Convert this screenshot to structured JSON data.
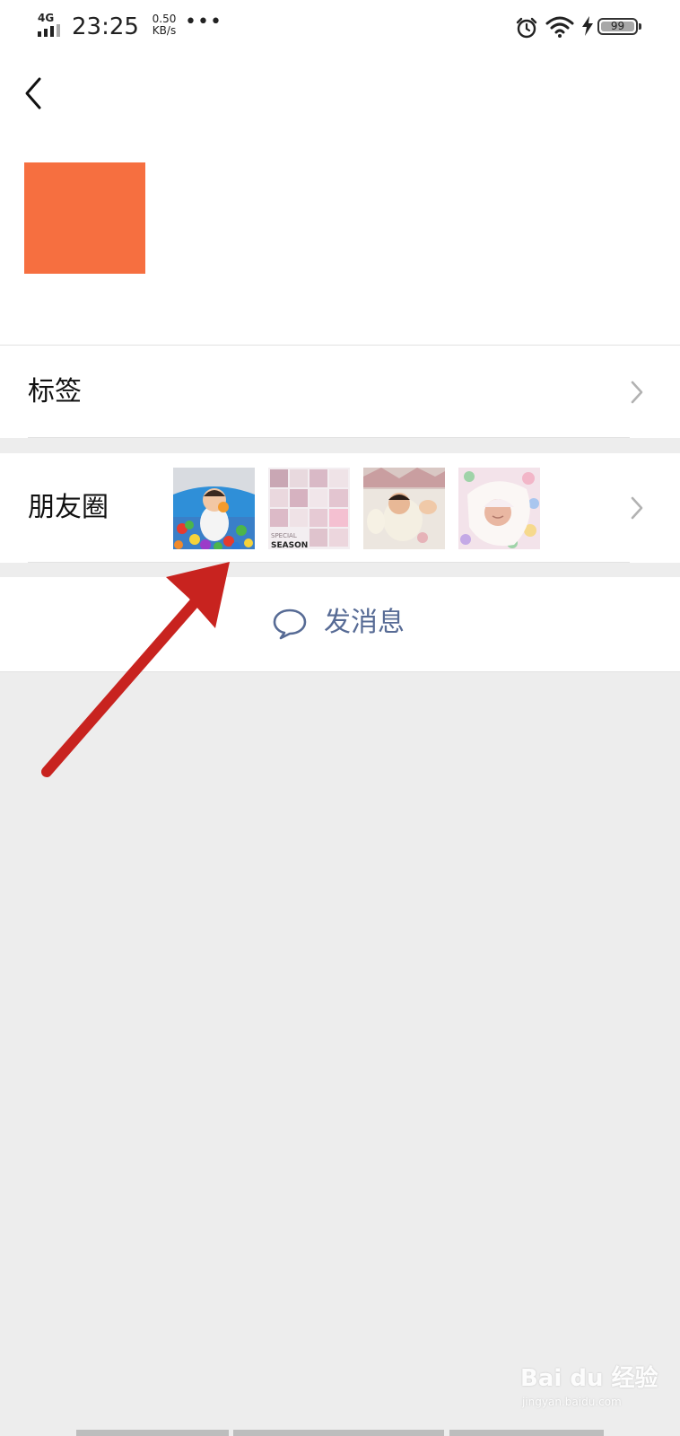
{
  "status_bar": {
    "network_type": "4G",
    "time": "23:25",
    "speed_value": "0.50",
    "speed_unit": "KB/s",
    "more": "•••",
    "battery_level": "99",
    "icons": [
      "signal-icon",
      "alarm-icon",
      "wifi-icon",
      "charging-icon",
      "battery-icon"
    ]
  },
  "nav": {
    "back_icon": "chevron-left-icon"
  },
  "profile": {
    "avatar_color": "#f66f40"
  },
  "rows": {
    "tags": {
      "label": "标签"
    },
    "moments": {
      "label": "朋友圈",
      "thumbnails": [
        {
          "name": "baby-in-ball-pool"
        },
        {
          "name": "pink-collage",
          "caption_small": "SPECIAL",
          "caption_big": "SEASON"
        },
        {
          "name": "newborn-on-bed"
        },
        {
          "name": "newborn-in-blanket"
        }
      ]
    }
  },
  "send_message": {
    "label": "发消息",
    "icon": "chat-bubble-icon",
    "color": "#576b95"
  },
  "annotation": {
    "arrow_color": "#c8231f"
  },
  "watermark": {
    "brand": "Bai du 经验",
    "url": "jingyan.baidu.com"
  }
}
